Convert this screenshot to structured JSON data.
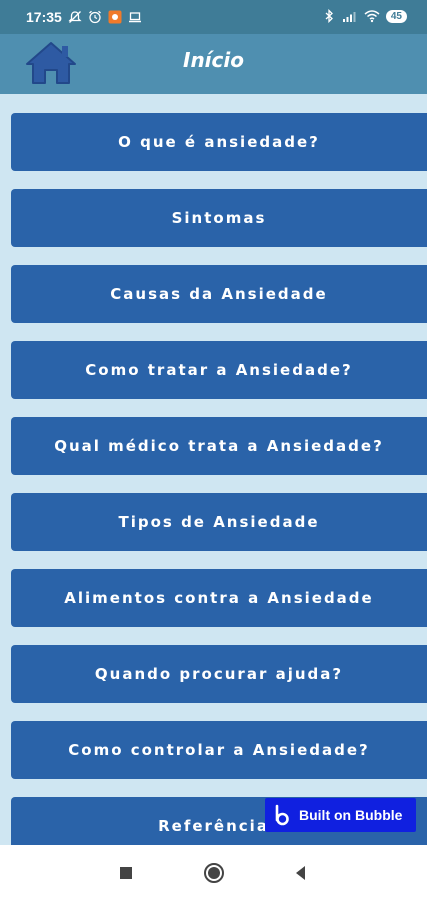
{
  "status_bar": {
    "time": "17:35",
    "battery": "45",
    "icons": [
      "mute-icon",
      "alarm-icon",
      "notification-app-icon",
      "laptop-icon",
      "bluetooth-icon",
      "signal-icon",
      "wifi-icon",
      "battery-icon"
    ]
  },
  "app_bar": {
    "title": "Início",
    "home_icon": "home-icon"
  },
  "menu": {
    "items": [
      {
        "label": "O que é ansiedade?"
      },
      {
        "label": "Sintomas"
      },
      {
        "label": "Causas da Ansiedade"
      },
      {
        "label": "Como tratar a Ansiedade?"
      },
      {
        "label": "Qual médico trata a Ansiedade?"
      },
      {
        "label": "Tipos de Ansiedade"
      },
      {
        "label": "Alimentos contra a Ansiedade"
      },
      {
        "label": "Quando procurar ajuda?"
      },
      {
        "label": "Como controlar a Ansiedade?"
      },
      {
        "label": "Referências"
      }
    ]
  },
  "badge": {
    "label": "Built on Bubble"
  },
  "nav_bar": {
    "icons": [
      "recents-icon",
      "home-circle-icon",
      "back-icon"
    ]
  },
  "colors": {
    "status_bar": "#3f7c97",
    "app_bar": "#4f8fb0",
    "background": "#cfe6f2",
    "button": "#2a63a9",
    "badge": "#1020e0"
  }
}
